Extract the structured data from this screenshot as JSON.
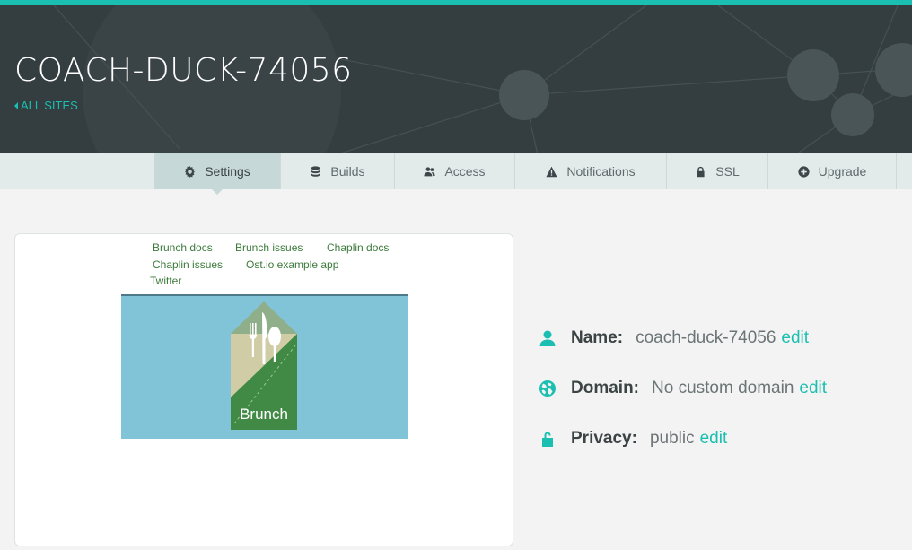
{
  "header": {
    "site_name": "COACH-DUCK-74056",
    "back_label": "ALL SITES"
  },
  "tabs": [
    {
      "label": "Settings",
      "icon": "gear-icon"
    },
    {
      "label": "Builds",
      "icon": "database-icon"
    },
    {
      "label": "Access",
      "icon": "users-icon"
    },
    {
      "label": "Notifications",
      "icon": "warning-icon"
    },
    {
      "label": "SSL",
      "icon": "lock-icon"
    },
    {
      "label": "Upgrade",
      "icon": "plus-circle-icon"
    }
  ],
  "preview": {
    "links": [
      "Brunch docs",
      "Brunch issues",
      "Chaplin docs",
      "Chaplin issues",
      "Ost.io example app",
      "Twitter"
    ],
    "banner_text": "Brunch",
    "banner_color": "#81c3d7"
  },
  "info": {
    "name_label": "Name:",
    "name_value": "coach-duck-74056",
    "domain_label": "Domain:",
    "domain_value": "No custom domain",
    "privacy_label": "Privacy:",
    "privacy_value": "public",
    "edit_label": "edit"
  },
  "colors": {
    "accent": "#1bbfb1",
    "header_bg": "#343d3f"
  }
}
